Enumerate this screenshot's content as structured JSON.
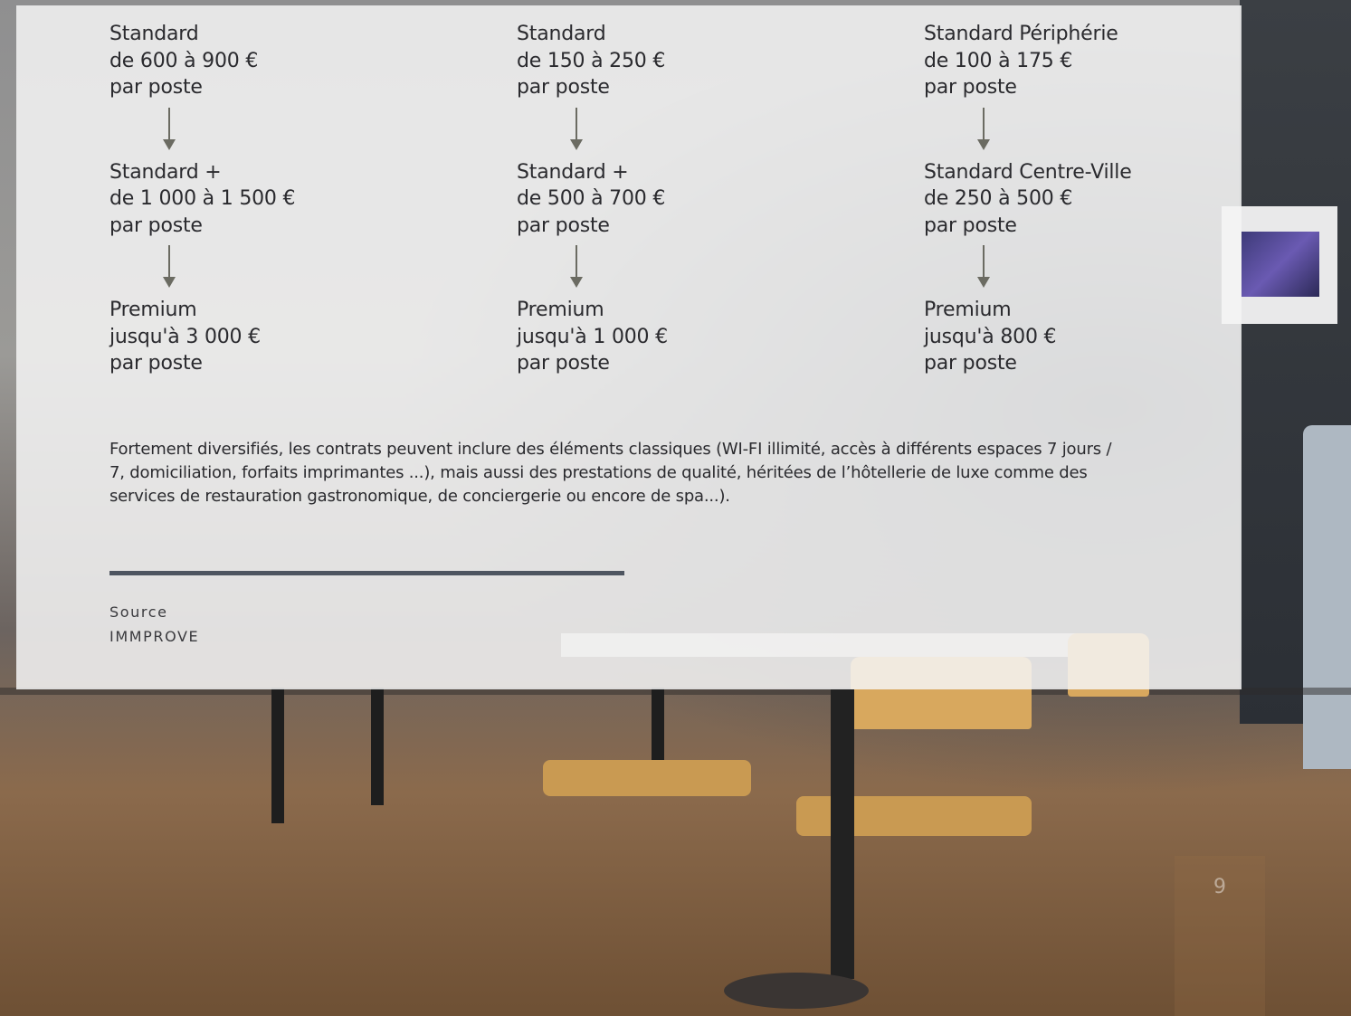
{
  "columns": [
    {
      "tiers": [
        {
          "name": "Standard",
          "price": "de 600 à 900 €",
          "unit": "par poste"
        },
        {
          "name": "Standard +",
          "price": "de 1 000 à 1 500 €",
          "unit": "par poste"
        },
        {
          "name": "Premium",
          "price": "jusqu'à 3 000 €",
          "unit": "par poste"
        }
      ]
    },
    {
      "tiers": [
        {
          "name": "Standard",
          "price": "de 150 à 250 €",
          "unit": "par poste"
        },
        {
          "name": "Standard +",
          "price": "de 500 à 700 €",
          "unit": "par poste"
        },
        {
          "name": "Premium",
          "price": "jusqu'à 1 000 €",
          "unit": "par poste"
        }
      ]
    },
    {
      "tiers": [
        {
          "name": "Standard Périphérie",
          "price": "de 100 à 175 €",
          "unit": "par poste"
        },
        {
          "name": "Standard Centre-Ville",
          "price": "de 250 à 500 €",
          "unit": "par poste"
        },
        {
          "name": "Premium",
          "price": "jusqu'à 800 €",
          "unit": "par poste"
        }
      ]
    }
  ],
  "note": "Fortement diversifiés, les contrats peuvent inclure des éléments classiques (WI-FI illimité, accès à différents espaces 7 jours / 7, domiciliation, forfaits imprimantes ...), mais aussi des prestations de qualité, héritées de l’hôtellerie de luxe comme des services de restauration gastronomique, de conciergerie ou encore de spa...).",
  "source": {
    "label": "Source",
    "name": "IMMPROVE"
  },
  "page_number": "9"
}
